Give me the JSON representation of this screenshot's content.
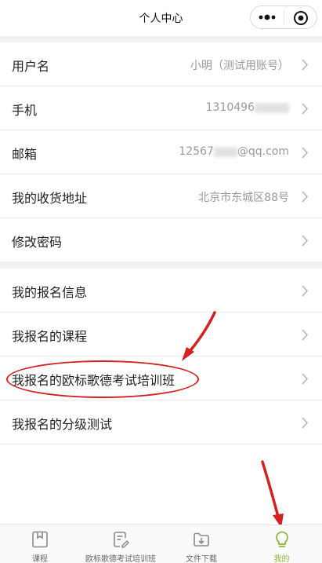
{
  "nav": {
    "title": "个人中心"
  },
  "profile_rows": [
    {
      "label": "用户名",
      "value": "小明（测试用账号）"
    },
    {
      "label": "手机",
      "value": "1310496"
    },
    {
      "label": "邮箱",
      "value_prefix": "12567",
      "value_suffix": "@qq.com"
    },
    {
      "label": "我的收货地址",
      "value": "北京市东城区88号"
    },
    {
      "label": "修改密码",
      "value": ""
    }
  ],
  "registration_rows": [
    {
      "label": "我的报名信息"
    },
    {
      "label": "我报名的课程"
    },
    {
      "label": "我报名的欧标歌德考试培训班"
    },
    {
      "label": "我报名的分级测试"
    }
  ],
  "tabbar": {
    "tabs": [
      {
        "label": "课程",
        "icon": "book-icon",
        "active": false
      },
      {
        "label": "欧标歌德考试培训班",
        "icon": "edit-doc-icon",
        "active": false
      },
      {
        "label": "文件下载",
        "icon": "folder-download-icon",
        "active": false
      },
      {
        "label": "我的",
        "icon": "lightbulb-icon",
        "active": true
      }
    ],
    "active_color": "#8cb83a"
  },
  "annotation_color": "#d42020"
}
